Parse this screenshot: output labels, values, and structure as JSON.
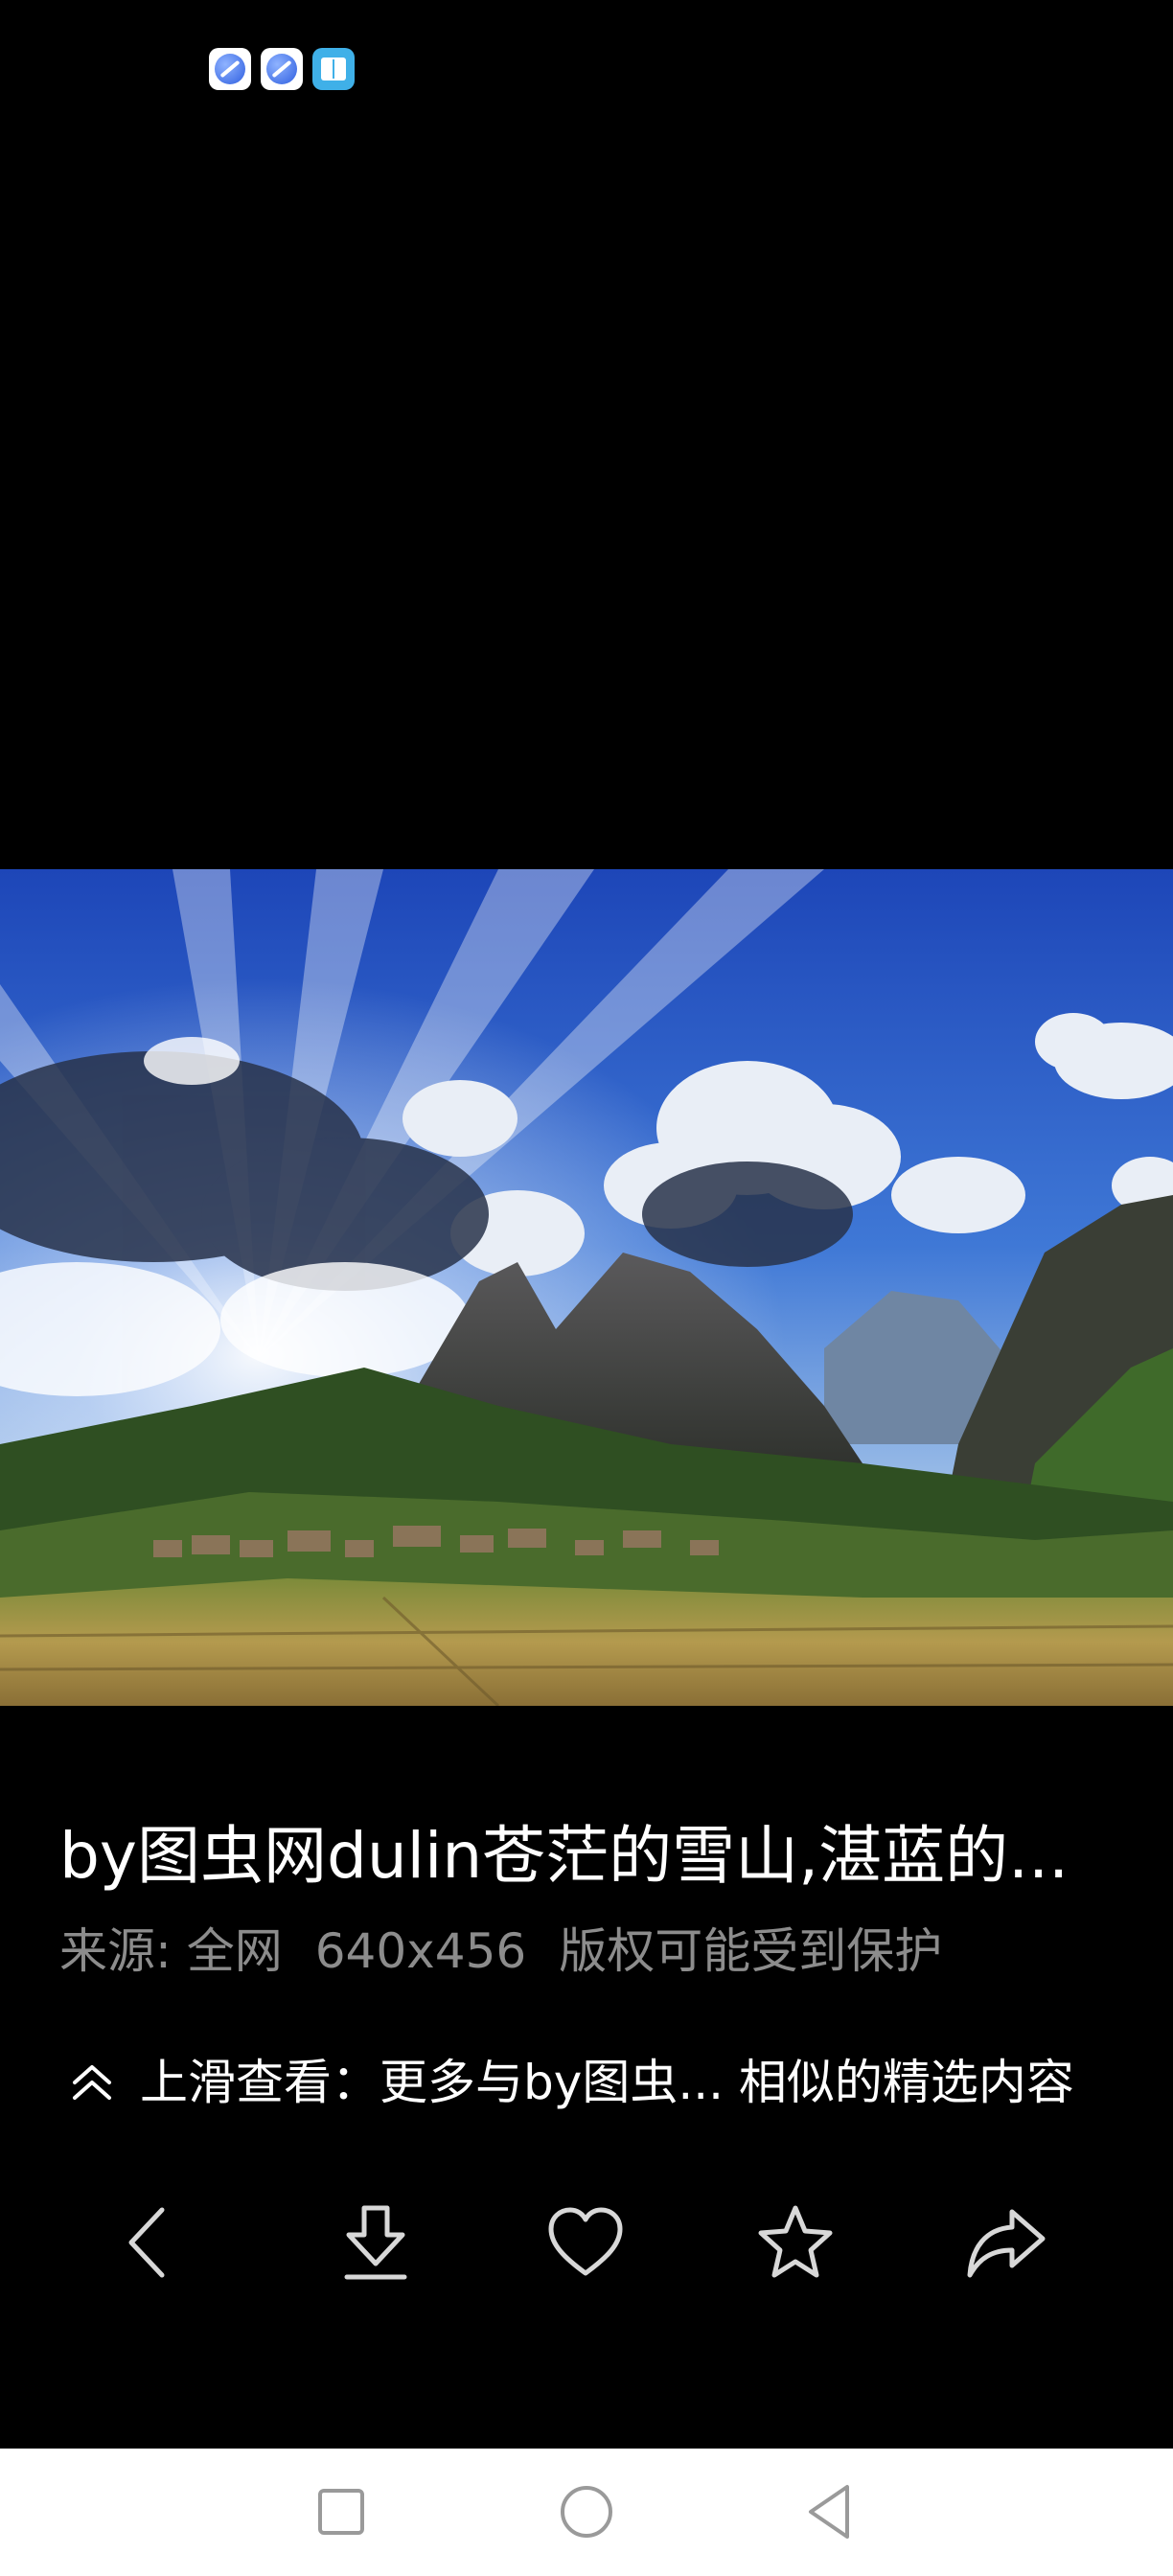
{
  "status_bar": {
    "app_icons": [
      "browser-icon",
      "browser-icon",
      "book-reader-icon"
    ]
  },
  "image": {
    "title": "by图虫网dulin苍茫的雪山,湛蓝的...",
    "source": "来源: 全网",
    "dimensions": "640x456",
    "copyright": "版权可能受到保护"
  },
  "swipe_hint": {
    "icon": "double-chevron-up-icon",
    "text": "上滑查看：更多与by图虫... 相似的精选内容"
  },
  "action_bar": {
    "items": [
      "back-icon",
      "download-icon",
      "heart-icon",
      "star-icon",
      "share-icon"
    ]
  },
  "nav_bar": {
    "items": [
      "recents-square-icon",
      "home-circle-icon",
      "back-triangle-icon"
    ]
  },
  "colors": {
    "background": "#000000",
    "meta_text": "#8c8c8c",
    "nav_bar_bg": "#ffffff"
  }
}
